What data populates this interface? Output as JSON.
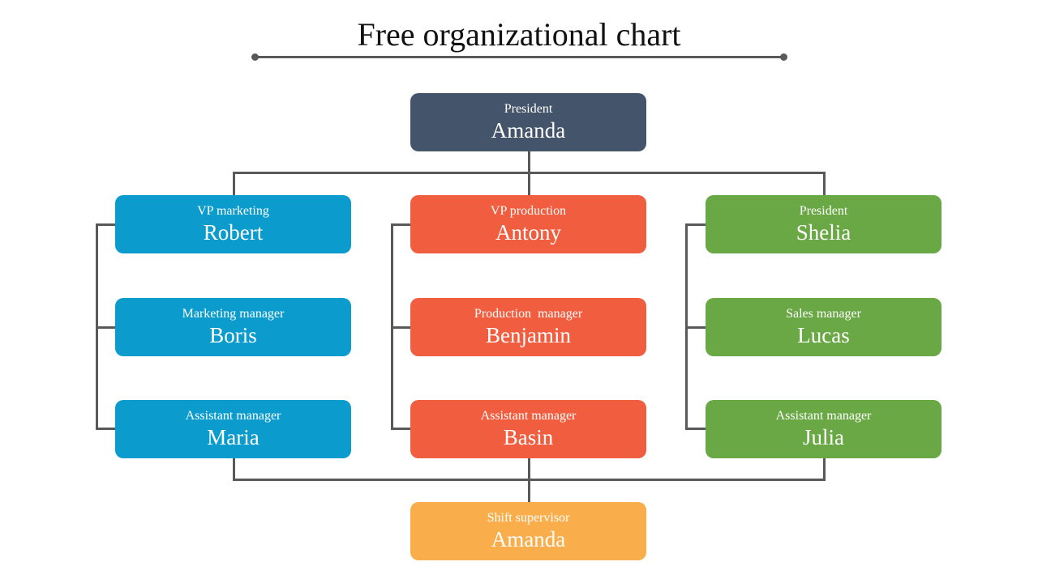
{
  "title": "Free organizational chart",
  "colors": {
    "executive": "#44546a",
    "marketing": "#0b9ccd",
    "production": "#f15d3f",
    "sales": "#69a844",
    "supervisor": "#f9ae4b",
    "connector": "#595959"
  },
  "top": {
    "role": "President",
    "name": "Amanda"
  },
  "columns": [
    {
      "department": "marketing",
      "nodes": [
        {
          "role": "VP marketing",
          "name": "Robert"
        },
        {
          "role": "Marketing manager",
          "name": "Boris"
        },
        {
          "role": "Assistant manager",
          "name": "Maria"
        }
      ]
    },
    {
      "department": "production",
      "nodes": [
        {
          "role": "VP production",
          "name": "Antony"
        },
        {
          "role": "Production  manager",
          "name": "Benjamin"
        },
        {
          "role": "Assistant manager",
          "name": "Basin"
        }
      ]
    },
    {
      "department": "sales",
      "nodes": [
        {
          "role": "President",
          "name": "Shelia"
        },
        {
          "role": "Sales manager",
          "name": "Lucas"
        },
        {
          "role": "Assistant manager",
          "name": "Julia"
        }
      ]
    }
  ],
  "bottom": {
    "role": "Shift supervisor",
    "name": "Amanda"
  }
}
